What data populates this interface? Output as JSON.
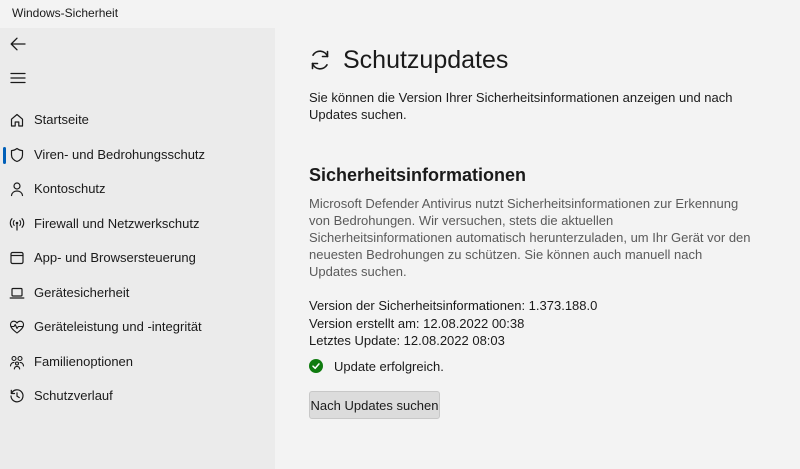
{
  "window": {
    "title": "Windows-Sicherheit"
  },
  "sidebar": {
    "items": [
      {
        "label": "Startseite",
        "icon": "home-icon"
      },
      {
        "label": "Viren- und Bedrohungsschutz",
        "icon": "shield-icon",
        "active": true
      },
      {
        "label": "Kontoschutz",
        "icon": "person-icon"
      },
      {
        "label": "Firewall und Netzwerkschutz",
        "icon": "wifi-antenna-icon"
      },
      {
        "label": "App- und Browsersteuerung",
        "icon": "app-window-icon"
      },
      {
        "label": "Gerätesicherheit",
        "icon": "laptop-icon"
      },
      {
        "label": "Geräteleistung und -integrität",
        "icon": "heart-pulse-icon"
      },
      {
        "label": "Familienoptionen",
        "icon": "family-icon"
      },
      {
        "label": "Schutzverlauf",
        "icon": "history-icon"
      }
    ]
  },
  "main": {
    "title": "Schutzupdates",
    "title_icon": "refresh-icon",
    "description": "Sie können die Version Ihrer Sicherheitsinformationen anzeigen und nach Updates suchen.",
    "section": {
      "title": "Sicherheitsinformationen",
      "description": "Microsoft Defender Antivirus nutzt Sicherheitsinformationen zur Erkennung von Bedrohungen. Wir versuchen, stets die aktuellen Sicherheitsinformationen automatisch herunterzuladen, um Ihr Gerät vor den neuesten Bedrohungen zu schützen. Sie können auch manuell nach Updates suchen.",
      "version": "Version der Sicherheitsinformationen: 1.373.188.0",
      "created": "Version erstellt am: 12.08.2022 00:38",
      "last_update": "Letztes Update: 12.08.2022 08:03",
      "status": "Update erfolgreich.",
      "status_color": "#0f7b0f",
      "button_label": "Nach Updates suchen"
    }
  },
  "colors": {
    "accent": "#005fb8",
    "sidebar_bg": "#ebebeb",
    "main_bg": "#f3f3f3"
  }
}
